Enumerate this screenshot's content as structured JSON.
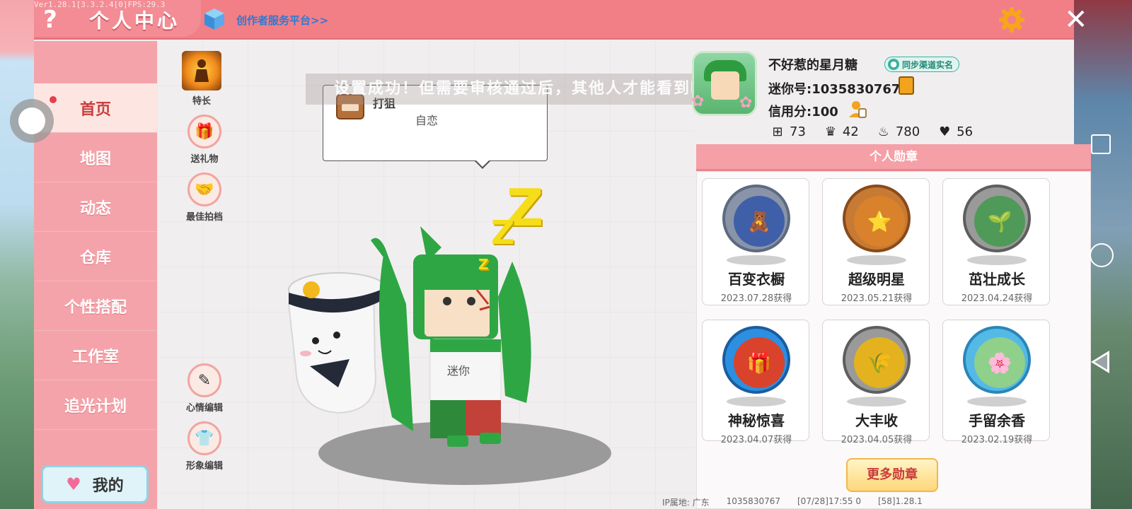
{
  "debug": "Ver1.28.1[3.3.2.4[0]FPS:29.3",
  "header": {
    "help_icon": "question-icon",
    "title": "个人中心",
    "creator_link": "创作者服务平台>>",
    "settings_icon": "gear-icon",
    "close_icon": "close-icon"
  },
  "sidebar": {
    "items": [
      {
        "label": "首页",
        "active": true
      },
      {
        "label": "地图"
      },
      {
        "label": "动态"
      },
      {
        "label": "仓库"
      },
      {
        "label": "个性搭配"
      },
      {
        "label": "工作室"
      },
      {
        "label": "追光计划"
      }
    ],
    "me_button": "我的"
  },
  "tools": {
    "specialty": "特长",
    "send_gift": "送礼物",
    "best_partner": "最佳拍档",
    "mood_edit": "心情编辑",
    "image_edit": "形象编辑"
  },
  "toast": "设置成功！但需要审核通过后，其他人才能看到哦",
  "bubble": {
    "name": "打狙",
    "message": "自恋"
  },
  "profile": {
    "nickname": "不好惹的星月糖",
    "realname_badge": "同步渠道实名",
    "uid": "迷你号:1035830767",
    "credit": "信用分:100",
    "stats": [
      {
        "icon": "plus-square-icon",
        "value": "73"
      },
      {
        "icon": "fans-icon",
        "value": "42"
      },
      {
        "icon": "fire-icon",
        "value": "780"
      },
      {
        "icon": "hearts-icon",
        "value": "56"
      }
    ]
  },
  "badges": {
    "header": "个人勋章",
    "items": [
      {
        "name": "百变衣橱",
        "date": "2023.07.28获得",
        "color": "#3f5fa8",
        "icon": "🧸"
      },
      {
        "name": "超级明星",
        "date": "2023.05.21获得",
        "color": "#d9822b",
        "icon": "⭐"
      },
      {
        "name": "茁壮成长",
        "date": "2023.04.24获得",
        "color": "#7a7a7a",
        "icon": "🌱"
      },
      {
        "name": "神秘惊喜",
        "date": "2023.04.07获得",
        "color": "#2d8fe0",
        "icon": "🎁"
      },
      {
        "name": "大丰收",
        "date": "2023.04.05获得",
        "color": "#e3b21e",
        "icon": "🌾"
      },
      {
        "name": "手留余香",
        "date": "2023.02.19获得",
        "color": "#55b9e6",
        "icon": "🌸"
      }
    ],
    "more_button": "更多勋章"
  },
  "footer": {
    "ip_location": "IP属地: 广东",
    "uid": "1035830767",
    "time": "[07/28]17:55 0",
    "version": "[58]1.28.1"
  }
}
